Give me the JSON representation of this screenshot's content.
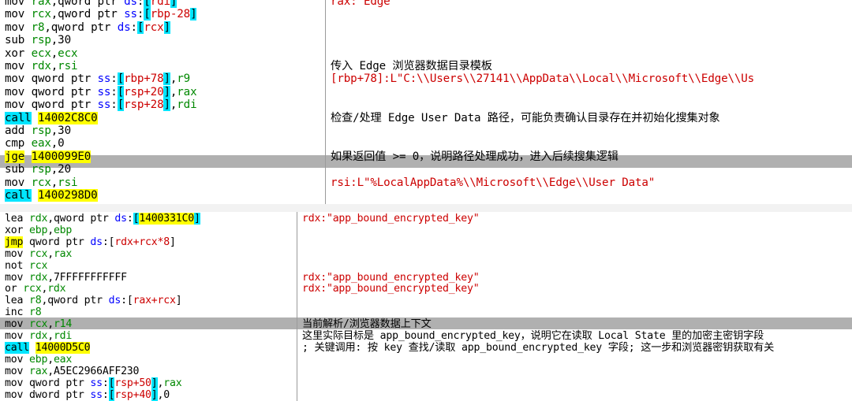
{
  "top_panel": {
    "code": [
      "mov rax,qword ptr ds:[rdi]",
      "mov rcx,qword ptr ss:[rbp-28]",
      "mov r8,qword ptr ds:[rcx]",
      "sub rsp,30",
      "xor ecx,ecx",
      "mov rdx,rsi",
      "mov qword ptr ss:[rbp+78],r9",
      "mov qword ptr ss:[rsp+20],rax",
      "mov qword ptr ss:[rsp+28],rdi",
      "call 14002C8C0",
      "add rsp,30",
      "cmp eax,0",
      "jge 1400099E0",
      "sub rsp,20",
      "mov rcx,rsi",
      "call 1400298D0"
    ],
    "comments": {
      "l0": "rax:\"Edge\"",
      "l5": "传入 Edge 浏览器数据目录模板",
      "l6": "[rbp+78]:L\"C:\\\\Users\\\\27141\\\\AppData\\\\Local\\\\Microsoft\\\\Edge\\\\Us",
      "l9": "检查/处理 Edge User Data 路径，可能负责确认目录存在并初始化搜集对象",
      "l12": "如果返回值 >= 0，说明路径处理成功，进入后续搜集逻辑",
      "l14": "rsi:L\"%LocalAppData%\\\\Microsoft\\\\Edge\\\\User Data\""
    }
  },
  "bottom_panel": {
    "code": [
      "lea rdx,qword ptr ds:[1400331C0]",
      "xor ebp,ebp",
      "jmp qword ptr ds:[rdx+rcx*8]",
      "mov rcx,rax",
      "not rcx",
      "mov rdx,7FFFFFFFFFFF",
      "or rcx,rdx",
      "lea r8,qword ptr ds:[rax+rcx]",
      "inc r8",
      "mov rcx,r14",
      "mov rdx,rdi",
      "call 14000D5C0",
      "mov ebp,eax",
      "mov rax,A5EC2966AFF230",
      "mov qword ptr ss:[rsp+50],rax",
      "mov dword ptr ss:[rsp+40],0"
    ],
    "comments": {
      "l0": "rdx:\"app_bound_encrypted_key\"",
      "l5": "rdx:\"app_bound_encrypted_key\"",
      "l6": "rdx:\"app_bound_encrypted_key\"",
      "l9": "当前解析/浏览器数据上下文",
      "l10": "这里实际目标是 app_bound_encrypted_key，说明它在读取 Local State 里的加密主密钥字段",
      "l11": "; 关键调用: 按 key 查找/读取 app_bound_encrypted_key 字段; 这一步和浏览器密钥获取有关"
    }
  }
}
